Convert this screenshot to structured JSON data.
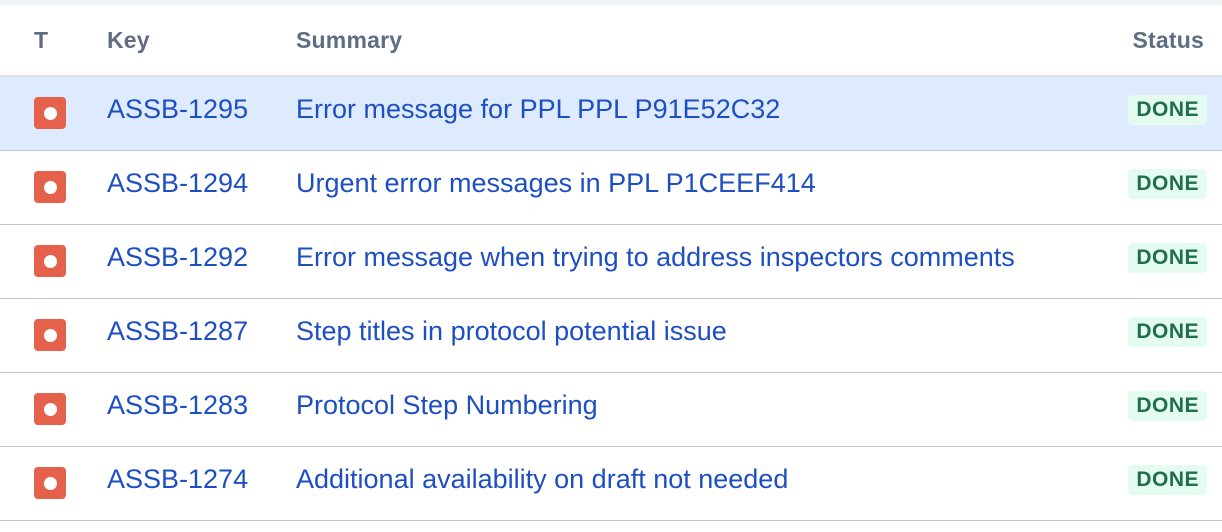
{
  "table": {
    "columns": {
      "type": "T",
      "key": "Key",
      "summary": "Summary",
      "status": "Status"
    },
    "rows": [
      {
        "type_icon": "bug-icon",
        "key": "ASSB-1295",
        "summary": "Error message for PPL PPL P91E52C32",
        "status": "DONE",
        "selected": true
      },
      {
        "type_icon": "bug-icon",
        "key": "ASSB-1294",
        "summary": "Urgent error messages in PPL P1CEEF414",
        "status": "DONE",
        "selected": false
      },
      {
        "type_icon": "bug-icon",
        "key": "ASSB-1292",
        "summary": "Error message when trying to address inspectors comments",
        "status": "DONE",
        "selected": false
      },
      {
        "type_icon": "bug-icon",
        "key": "ASSB-1287",
        "summary": "Step titles in protocol potential issue",
        "status": "DONE",
        "selected": false
      },
      {
        "type_icon": "bug-icon",
        "key": "ASSB-1283",
        "summary": "Protocol Step Numbering",
        "status": "DONE",
        "selected": false
      },
      {
        "type_icon": "bug-icon",
        "key": "ASSB-1274",
        "summary": "Additional availability on draft not needed",
        "status": "DONE",
        "selected": false
      }
    ]
  },
  "colors": {
    "link": "#1d4fc3",
    "bug_icon": "#e5614c",
    "status_done_bg": "#e3fcef",
    "status_done_text": "#216e4e",
    "selected_row_bg": "#deebff"
  }
}
